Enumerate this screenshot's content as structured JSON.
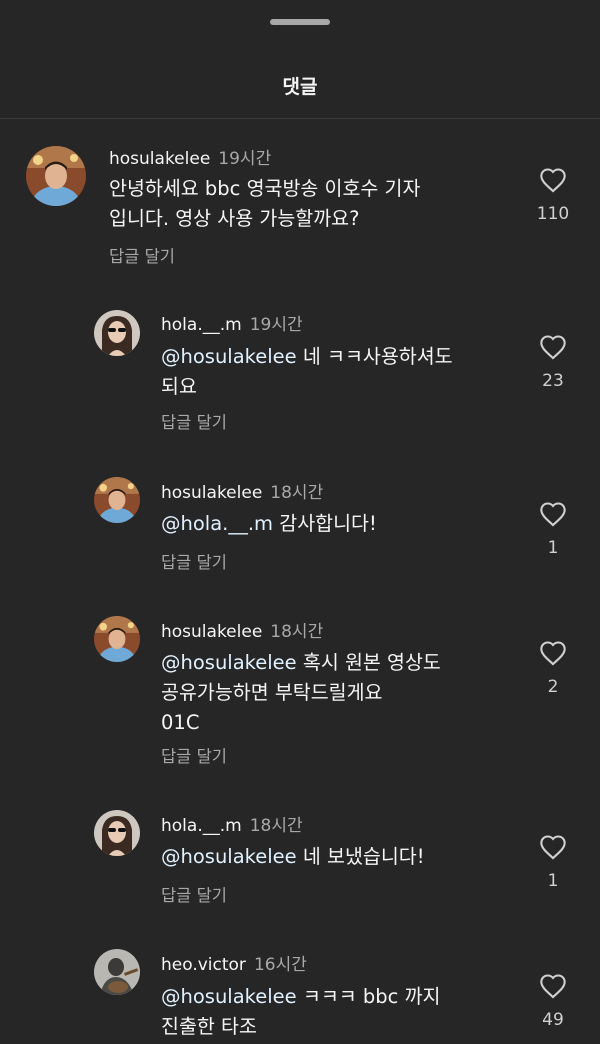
{
  "header": {
    "title": "댓글"
  },
  "comments": [
    {
      "username": "hosulakelee",
      "time": "19시간",
      "mention": "",
      "lines": [
        "안녕하세요 bbc 영국방송 이호수 기자",
        "입니다. 영상 사용 가능할까요?"
      ],
      "reply_label": "답글 달기",
      "likes": "110",
      "avatar": "man-avatar"
    },
    {
      "username": "hola.__.m",
      "time": "19시간",
      "mention": "@hosulakelee",
      "lines": [
        " 네 ㅋㅋ사용하셔도",
        "되요"
      ],
      "reply_label": "답글 달기",
      "likes": "23",
      "avatar": "woman-avatar"
    },
    {
      "username": "hosulakelee",
      "time": "18시간",
      "mention": "@hola.__.m",
      "lines": [
        " 감사합니다!"
      ],
      "reply_label": "답글 달기",
      "likes": "1",
      "avatar": "man-avatar"
    },
    {
      "username": "hosulakelee",
      "time": "18시간",
      "mention": "@hosulakelee",
      "lines": [
        " 혹시 원본 영상도",
        "공유가능하면 부탁드릴게요",
        "01C"
      ],
      "reply_label": "답글 달기",
      "likes": "2",
      "avatar": "man-avatar"
    },
    {
      "username": "hola.__.m",
      "time": "18시간",
      "mention": "@hosulakelee",
      "lines": [
        " 네 보냈습니다!"
      ],
      "reply_label": "답글 달기",
      "likes": "1",
      "avatar": "woman-avatar"
    },
    {
      "username": "heo.victor",
      "time": "16시간",
      "mention": "@hosulakelee",
      "lines": [
        " ㅋㅋㅋ bbc 까지",
        "진출한 타조"
      ],
      "reply_label": "",
      "likes": "49",
      "avatar": "guitar-avatar"
    }
  ]
}
